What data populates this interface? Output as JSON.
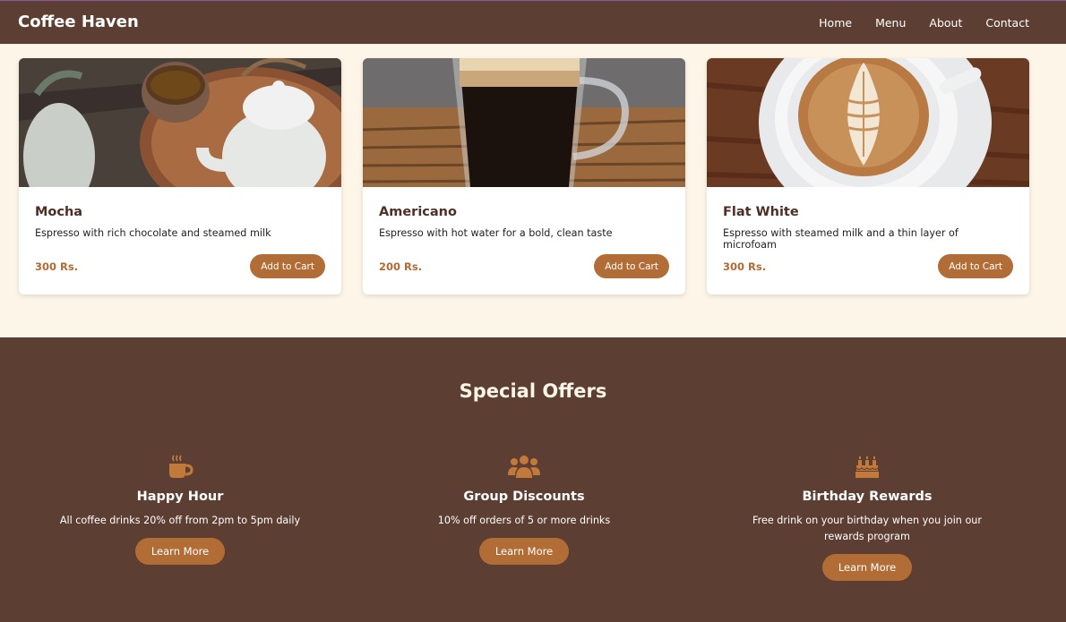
{
  "nav": {
    "brand": "Coffee Haven",
    "links": [
      "Home",
      "Menu",
      "About",
      "Contact"
    ]
  },
  "products": [
    {
      "name": "Mocha",
      "description": "Espresso with rich chocolate and steamed milk",
      "price": "300 Rs.",
      "button": "Add to Cart"
    },
    {
      "name": "Americano",
      "description": "Espresso with hot water for a bold, clean taste",
      "price": "200 Rs.",
      "button": "Add to Cart"
    },
    {
      "name": "Flat White",
      "description": "Espresso with steamed milk and a thin layer of microfoam",
      "price": "300 Rs.",
      "button": "Add to Cart"
    }
  ],
  "offers": {
    "title": "Special Offers",
    "items": [
      {
        "icon": "coffee-cup-icon",
        "title": "Happy Hour",
        "description": "All coffee drinks 20% off from 2pm to 5pm daily",
        "button": "Learn More"
      },
      {
        "icon": "users-group-icon",
        "title": "Group Discounts",
        "description": "10% off orders of 5 or more drinks",
        "button": "Learn More"
      },
      {
        "icon": "birthday-cake-icon",
        "title": "Birthday Rewards",
        "description": "Free drink on your birthday when you join our rewards program",
        "button": "Learn More"
      }
    ]
  },
  "colors": {
    "header_bg": "#5d3e32",
    "page_bg": "#fdf6e8",
    "accent": "#b26d36",
    "price": "#b06b35"
  }
}
